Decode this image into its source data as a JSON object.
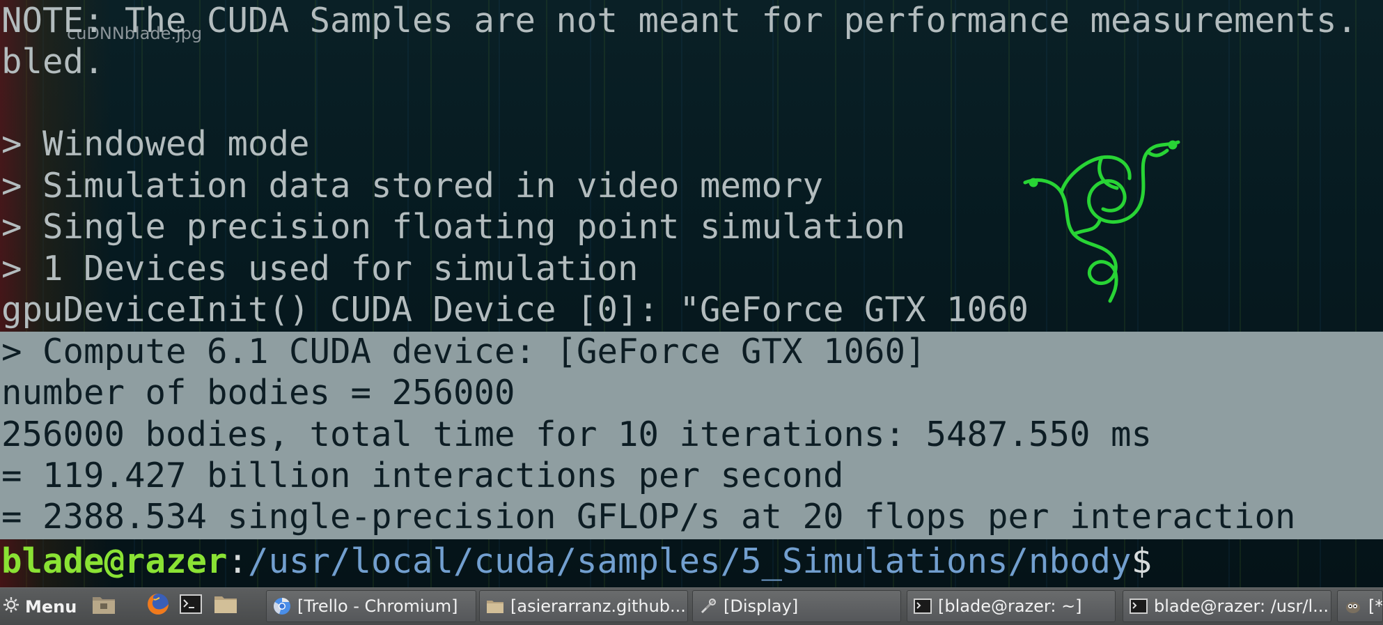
{
  "wallpaper": {
    "file_label": "cuDNNblade.jpg",
    "logo_icon": "razer-snake-logo",
    "colors": {
      "logo": "#28d435",
      "background": "#06161b"
    }
  },
  "terminal": {
    "lines": [
      "NOTE: The CUDA Samples are not meant for performance measurements.",
      "bled.",
      "",
      "> Windowed mode",
      "> Simulation data stored in video memory",
      "> Single precision floating point simulation",
      "> 1 Devices used for simulation",
      "gpuDeviceInit() CUDA Device [0]: \"GeForce GTX 1060"
    ],
    "selected_lines": [
      "> Compute 6.1 CUDA device: [GeForce GTX 1060]",
      "number of bodies = 256000",
      "256000 bodies, total time for 10 iterations: 5487.550 ms",
      "= 119.427 billion interactions per second",
      "= 2388.534 single-precision GFLOP/s at 20 flops per interaction"
    ],
    "prompt": {
      "user_host": "blade@razer",
      "separator": ":",
      "path": "/usr/local/cuda/samples/5_Simulations/nbody",
      "symbol": "$"
    },
    "colors": {
      "text": "#b3bcbe",
      "selection_bg": "#8f9ea1",
      "selection_text": "#0d1d24",
      "prompt_user": "#8ae234",
      "prompt_path": "#729fcf"
    }
  },
  "taskbar": {
    "menu": {
      "label": "Menu",
      "icon": "gear-icon"
    },
    "launchers": [
      {
        "name": "desktop-launcher",
        "icon": "desktop-folder-icon"
      },
      {
        "name": "firefox-launcher",
        "icon": "firefox-icon"
      },
      {
        "name": "terminal-launcher",
        "icon": "terminal-icon"
      },
      {
        "name": "files-launcher",
        "icon": "folder-icon"
      }
    ],
    "tasks": [
      {
        "label": "[Trello - Chromium]",
        "icon": "chromium-icon"
      },
      {
        "label": "[asierarranz.github....",
        "icon": "folder-icon"
      },
      {
        "label": "[Display]",
        "icon": "tools-icon"
      },
      {
        "label": "[blade@razer: ~]",
        "icon": "terminal-icon"
      },
      {
        "label": "blade@razer: /usr/l...",
        "icon": "terminal-icon"
      },
      {
        "label": "[*",
        "icon": "gimp-icon"
      }
    ]
  }
}
